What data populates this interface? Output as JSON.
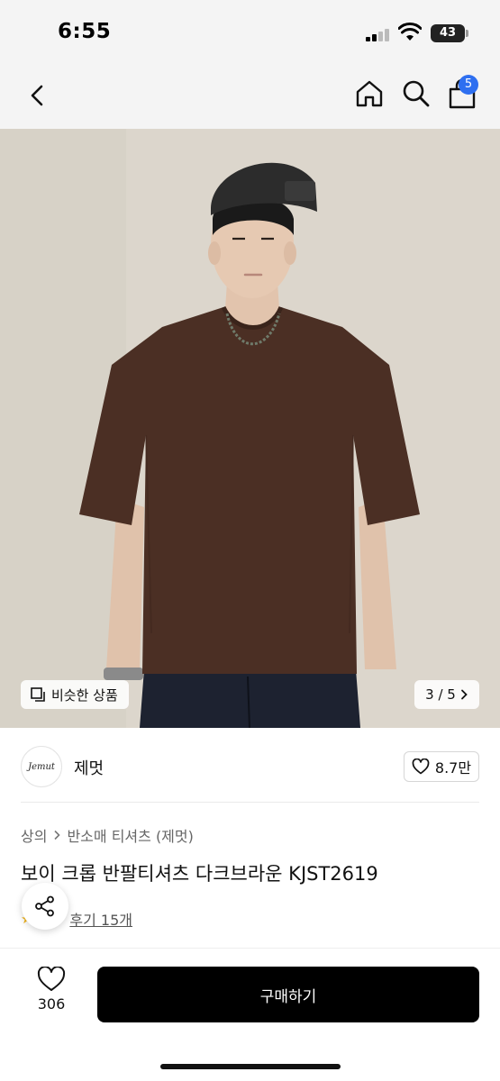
{
  "status_bar": {
    "time": "6:55",
    "battery": "43"
  },
  "nav": {
    "cart_count": "5"
  },
  "hero": {
    "similar_label": "비슷한 상품",
    "page_indicator": "3 / 5",
    "colors": {
      "tshirt": "#4b2f24",
      "background": "#dcd6cc"
    }
  },
  "seller": {
    "logo_text": "Jemut",
    "name": "제멋",
    "likes": "8.7만"
  },
  "product": {
    "breadcrumb": [
      "상의",
      "반소매 티셔츠 (제멋)"
    ],
    "title": "보이 크롭 반팔티셔츠 다크브라운 KJST2619",
    "rating": "5",
    "review_link": "후기 15개"
  },
  "bottom_bar": {
    "wish_count": "306",
    "buy_label": "구매하기"
  },
  "theme": {
    "badge_color": "#2e6ff0",
    "buy_button_color": "#000000"
  }
}
